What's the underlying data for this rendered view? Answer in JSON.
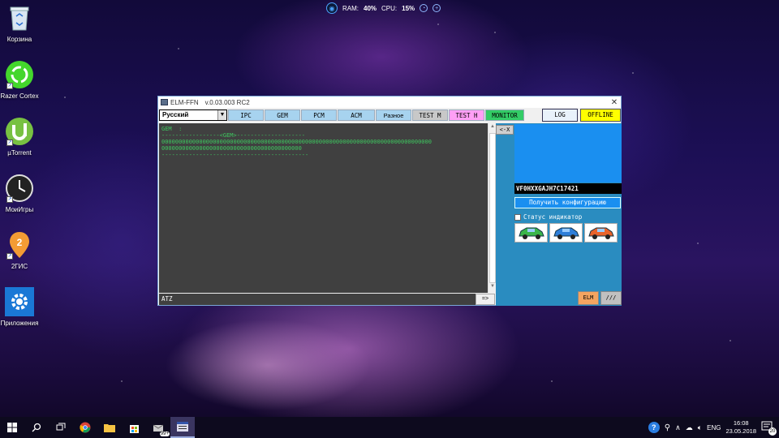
{
  "system_widget": {
    "ram_label": "RAM:",
    "ram_value": "40%",
    "cpu_label": "CPU:",
    "cpu_value": "15%"
  },
  "desktop": {
    "icons": [
      {
        "label": "Корзина",
        "icon": "recycle-bin-icon"
      },
      {
        "label": "Razer Cortex",
        "icon": "razer-cortex-icon"
      },
      {
        "label": "µTorrent",
        "icon": "utorrent-icon"
      },
      {
        "label": "МоиИгры",
        "icon": "clock-icon"
      },
      {
        "label": "2ГИС",
        "icon": "map-pin-icon"
      },
      {
        "label": "Приложения",
        "icon": "gear-icon"
      }
    ]
  },
  "window": {
    "title": "ELM-FFN",
    "version": "v.0.03.003 RC2",
    "close_glyph": "✕",
    "language": "Русский",
    "toolbar": [
      {
        "label": "IPC",
        "color": "#a7d3ef"
      },
      {
        "label": "GEM",
        "color": "#a7d3ef"
      },
      {
        "label": "PCM",
        "color": "#a7d3ef"
      },
      {
        "label": "ACM",
        "color": "#a7d3ef"
      },
      {
        "label": "Разное",
        "color": "#a7d3ef"
      },
      {
        "label": "TEST M",
        "color": "#c8c8c8"
      },
      {
        "label": "TEST H",
        "color": "#ff9ff5"
      },
      {
        "label": "MONITOR",
        "color": "#33cc66"
      }
    ],
    "log_button": "LOG",
    "offline_button": "OFFLINE",
    "console_lines": [
      "GEM  :",
      "-----------------<GEM>--------------------",
      "0000000000000000000000000000000000000000000000000000000000000000000000000000000",
      "00000000000000000000000000000000000000000",
      "-------------------------------------------"
    ],
    "clear_button": "<-X",
    "command_value": "ATZ",
    "send_button": "=>",
    "vin": "VF0HXXGAJH7C17421",
    "get_config_button": "Получить конфигурацию",
    "status_indicator_label": "Статус индикатор",
    "status_indicator_checked": false,
    "cars": [
      {
        "color": "#3ab54a"
      },
      {
        "color": "#2f7fd9"
      },
      {
        "color": "#e8632b"
      }
    ],
    "elm_button": "ELM",
    "slash_button": "///"
  },
  "taskbar": {
    "badge": "99+",
    "lang": "ENG",
    "time": "16:08",
    "date": "23.05.2018",
    "notification_count": "20"
  }
}
